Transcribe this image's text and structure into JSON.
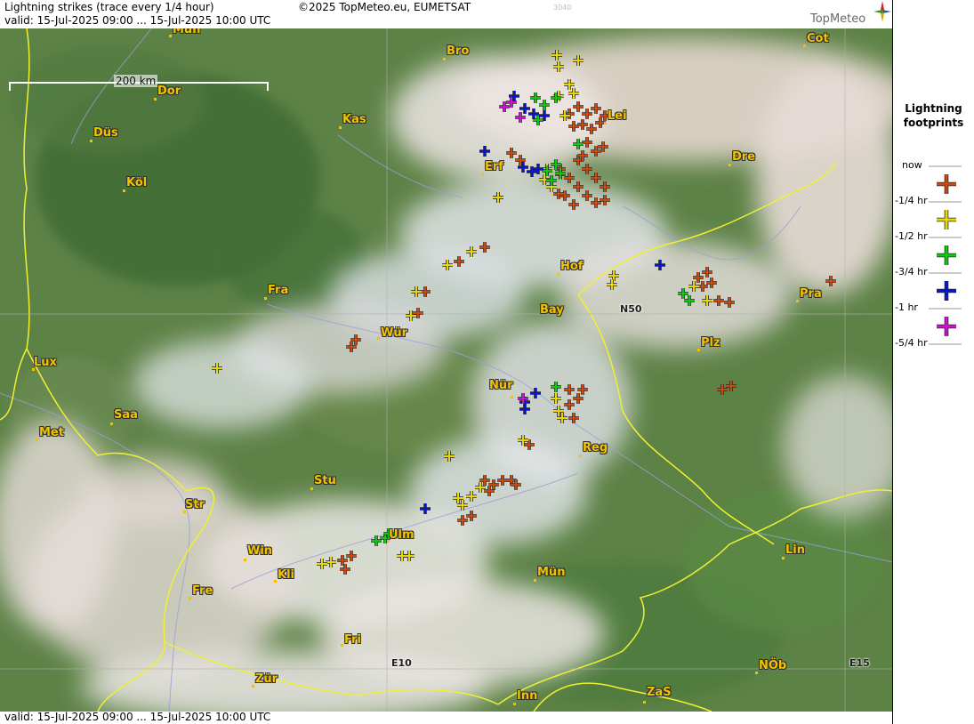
{
  "header": {
    "title": "Lightning strikes (trace every 1/4 hour)",
    "valid": "valid:  15-Jul-2025 09:00 ... 15-Jul-2025 10:00 UTC",
    "copyright": "©2025 TopMeteo.eu, EUMETSAT",
    "image_id": "3040",
    "logo_text": "TopMeteo"
  },
  "footer": {
    "valid": "valid:  15-Jul-2025 09:00 ... 15-Jul-2025 10:00 UTC"
  },
  "scale_label": "200 km",
  "grid_labels": {
    "n50": "N50",
    "e10": "E10",
    "e15": "E15"
  },
  "cities": [
    "Mün",
    "Bro",
    "Cot",
    "Dor",
    "Kas",
    "Lei",
    "Düs",
    "Erf",
    "Dre",
    "Köl",
    "Hof",
    "Fra",
    "Pra",
    "Bay",
    "Wür",
    "Plz",
    "Lux",
    "Nür",
    "Saa",
    "Reg",
    "Met",
    "Stu",
    "Str",
    "Ulm",
    "Win",
    "Kli",
    "Mün",
    "Lin",
    "Fre",
    "Fri",
    "NÖb",
    "Zür",
    "Inn",
    "ZaS"
  ],
  "legend": {
    "title_line1": "Lightning",
    "title_line2": "footprints",
    "now_label": "now",
    "items": [
      {
        "label": "-1/4 hr",
        "color": "#c84a10"
      },
      {
        "label": "-1/2 hr",
        "color": "#e6d800"
      },
      {
        "label": "-3/4 hr",
        "color": "#10c810"
      },
      {
        "label": "-1 hr",
        "color": "#0a14c8"
      },
      {
        "label": "-5/4 hr",
        "color": "#d010d0"
      }
    ]
  }
}
